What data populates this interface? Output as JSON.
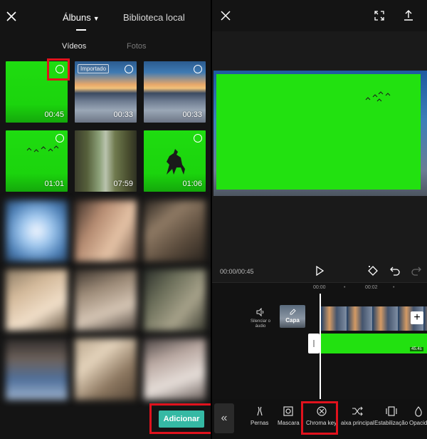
{
  "left": {
    "tabs": {
      "albums": "Álbuns",
      "local": "Biblioteca local"
    },
    "subtabs": {
      "videos": "Vídeos",
      "photos": "Fotos"
    },
    "thumbs": [
      {
        "duration": "00:45",
        "badge": ""
      },
      {
        "duration": "00:33",
        "badge": "Importado"
      },
      {
        "duration": "00:33",
        "badge": ""
      },
      {
        "duration": "01:01",
        "badge": ""
      },
      {
        "duration": "07:59",
        "badge": ""
      },
      {
        "duration": "01:06",
        "badge": ""
      }
    ],
    "add_button": "Adicionar"
  },
  "editor": {
    "time": "00:00/00:45",
    "ruler": [
      "00:00",
      "00:02"
    ],
    "mute_label": "Silenciar o áudio",
    "cover_label": "Capa",
    "clip_duration": "45.4s",
    "tools": [
      "Pernas",
      "Mascara",
      "Chroma key",
      "aixa principal",
      "Estabilização",
      "Opacid"
    ]
  },
  "colors": {
    "chroma_green": "#22e110",
    "accent_teal": "#35b9a4",
    "highlight_red": "#e0121d"
  },
  "icons": [
    "close-icon",
    "chevron-down-icon",
    "fullscreen-icon",
    "export-icon",
    "play-icon",
    "keyframe-icon",
    "undo-icon",
    "redo-icon",
    "volume-icon",
    "edit-icon",
    "plus-icon",
    "collapse-icon"
  ]
}
